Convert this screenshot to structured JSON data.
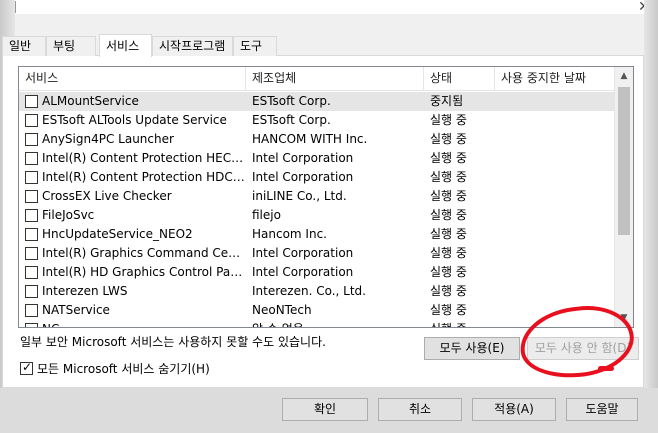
{
  "tabs": [
    "일반",
    "부팅",
    "서비스",
    "시작프로그램",
    "도구"
  ],
  "active_tab": 2,
  "columns": [
    "서비스",
    "제조업체",
    "상태",
    "사용 중지한 날짜"
  ],
  "rows": [
    {
      "service": "ALMountService",
      "vendor": "ESTsoft Corp.",
      "status": "중지됨",
      "date": "",
      "checked": false
    },
    {
      "service": "ESTsoft ALTools Update Service",
      "vendor": "ESTsoft Corp.",
      "status": "실행 중",
      "date": "",
      "checked": false
    },
    {
      "service": "AnySign4PC Launcher",
      "vendor": "HANCOM WITH Inc.",
      "status": "실행 중",
      "date": "",
      "checked": false
    },
    {
      "service": "Intel(R) Content Protection HECI Se...",
      "vendor": "Intel Corporation",
      "status": "실행 중",
      "date": "",
      "checked": false
    },
    {
      "service": "Intel(R) Content Protection HDCP S...",
      "vendor": "Intel Corporation",
      "status": "실행 중",
      "date": "",
      "checked": false
    },
    {
      "service": "CrossEX Live Checker",
      "vendor": "iniLINE Co., Ltd.",
      "status": "실행 중",
      "date": "",
      "checked": false
    },
    {
      "service": "FileJoSvc",
      "vendor": "filejo",
      "status": "실행 중",
      "date": "",
      "checked": false
    },
    {
      "service": "HncUpdateService_NEO2",
      "vendor": "Hancom Inc.",
      "status": "실행 중",
      "date": "",
      "checked": false
    },
    {
      "service": "Intel(R) Graphics Command Center ...",
      "vendor": "Intel Corporation",
      "status": "실행 중",
      "date": "",
      "checked": false
    },
    {
      "service": "Intel(R) HD Graphics Control Panel ...",
      "vendor": "Intel Corporation",
      "status": "실행 중",
      "date": "",
      "checked": false
    },
    {
      "service": "Interezen LWS",
      "vendor": "Interezen. Co., Ltd.",
      "status": "실행 중",
      "date": "",
      "checked": false
    },
    {
      "service": "NATService",
      "vendor": "NeoNTech",
      "status": "실행 중",
      "date": "",
      "checked": false
    },
    {
      "service": "NC...",
      "vendor": "알 수 없음",
      "status": "실행 중",
      "date": "",
      "checked": false
    }
  ],
  "note": "일부 보안 Microsoft 서비스는 사용하지 못할 수도 있습니다.",
  "enable_all_label": "모두 사용(E)",
  "disable_all_label": "모두 사용 안 함(D)",
  "hide_ms_label": "모든 Microsoft 서비스 숨기기(H)",
  "hide_ms_checked": true,
  "ok_label": "확인",
  "cancel_label": "취소",
  "apply_label": "적용(A)",
  "help_label": "도움말",
  "close_glyph": "✕",
  "accent_color": "#e8101e"
}
